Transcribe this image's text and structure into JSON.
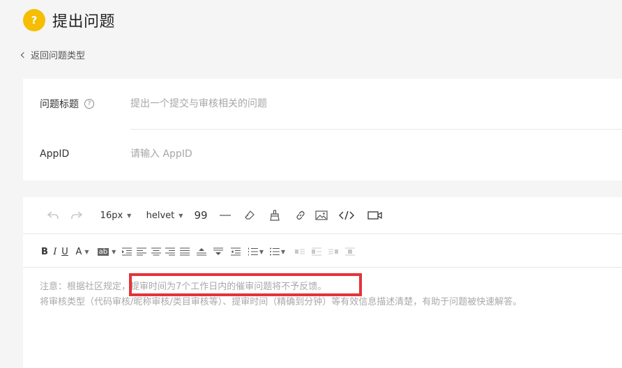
{
  "header": {
    "icon_text": "?",
    "title": "提出问题"
  },
  "back_link": {
    "label": "返回问题类型"
  },
  "form": {
    "title_label": "问题标题",
    "title_help_icon": "?",
    "title_placeholder": "提出一个提交与审核相关的问题",
    "appid_label": "AppID",
    "appid_placeholder": "请输入 AppID"
  },
  "editor": {
    "toolbar": {
      "font_size": "16px",
      "font_family": "helvet",
      "quote_glyph": "99"
    },
    "format_toolbar": {
      "bold": "B",
      "italic": "I",
      "underline": "U",
      "font_color": "A",
      "bg_color": "ab"
    },
    "notice_line1_prefix": "注意：根据社区规定，",
    "notice_line1_highlight": "提审时间为7个工作日内的催审问题将不予反馈。",
    "notice_line2": "将审核类型（代码审核/昵称审核/类目审核等）、提审时间（精确到分钟）等有效信息描述清楚，有助于问题被快速解答。"
  }
}
